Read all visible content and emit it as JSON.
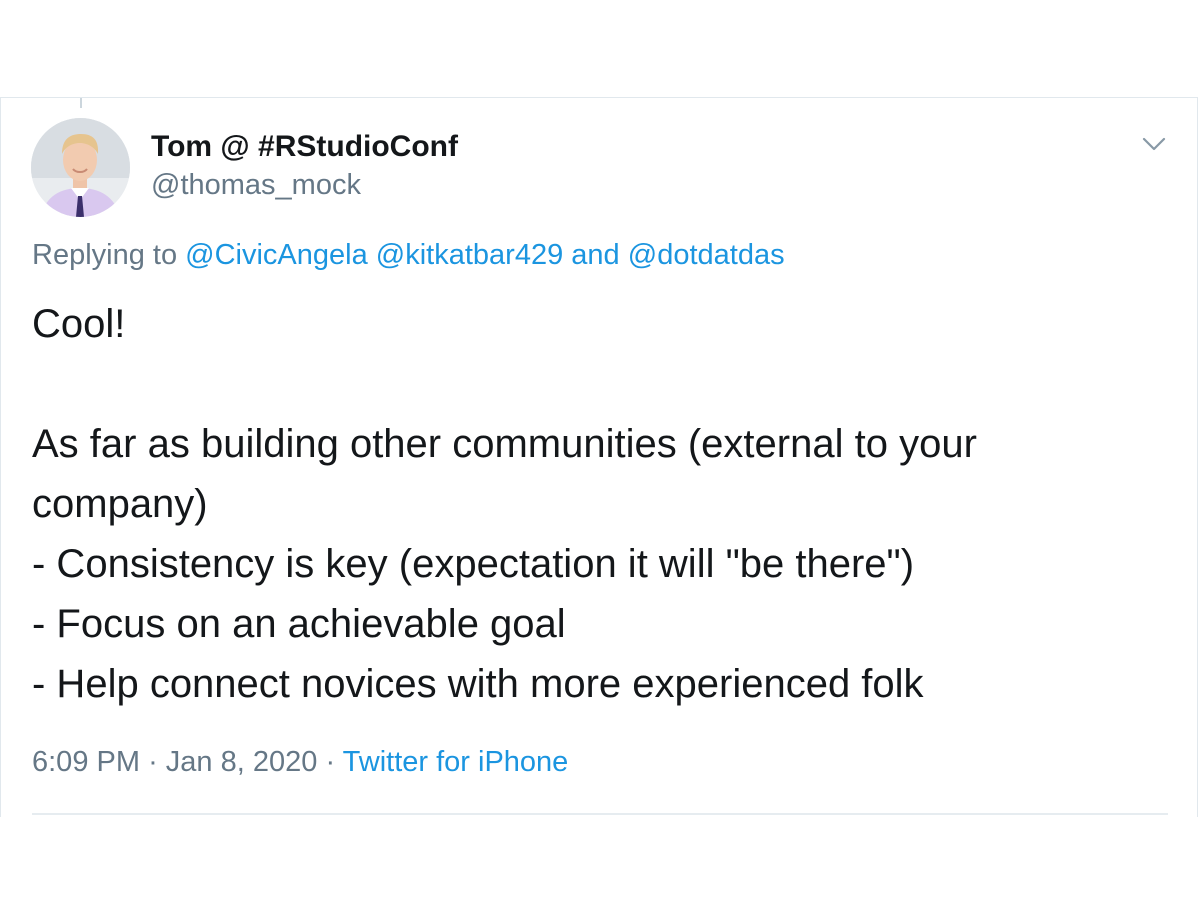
{
  "tweet": {
    "author": {
      "name": "Tom @ #RStudioConf",
      "handle": "@thomas_mock",
      "avatar_icon": "person-avatar-icon"
    },
    "menu_icon": "chevron-down-icon",
    "reply": {
      "prefix": "Replying to",
      "mentions": [
        "@CivicAngela",
        "@kitkatbar429"
      ],
      "conjunction": "and",
      "last_mention": "@dotdatdas"
    },
    "body": {
      "line1": "Cool!",
      "line2": "As far as building other communities (external to your",
      "line3": "company)",
      "line4": "- Consistency is key (expectation it will \"be there\")",
      "line5": "- Focus on an achievable goal",
      "line6": "- Help connect novices with more experienced folk"
    },
    "meta": {
      "time": "6:09 PM",
      "separator": "·",
      "date": "Jan 8, 2020",
      "source": "Twitter for iPhone"
    }
  },
  "colors": {
    "text": "#14171a",
    "secondary": "#657786",
    "link": "#1b95e0",
    "border": "#e1e8ed"
  }
}
